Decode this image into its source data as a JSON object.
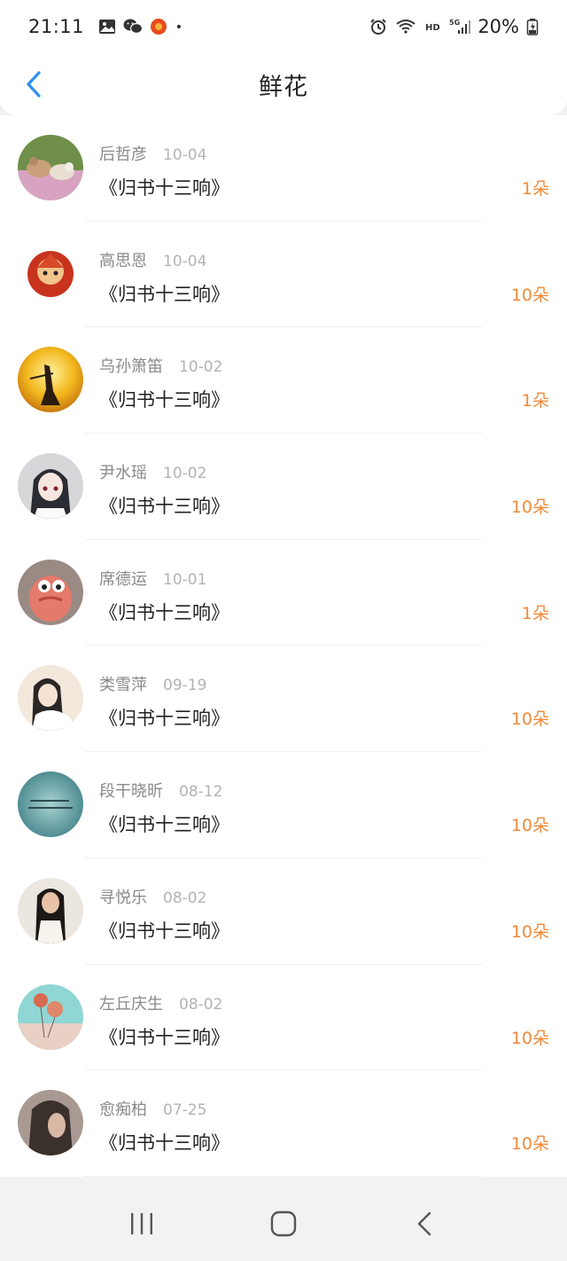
{
  "status_bar": {
    "time": "21:11",
    "battery": "20%",
    "icons_left": [
      "gallery-icon",
      "wechat-icon",
      "app-badge-icon",
      "dot-icon"
    ],
    "icons_right": [
      "alarm-icon",
      "wifi-icon",
      "hd-icon",
      "signal-5g-icon",
      "battery-charging-icon"
    ]
  },
  "header": {
    "title": "鲜花",
    "back_icon": "chevron-left-icon"
  },
  "list": [
    {
      "name": "后哲彦",
      "date": "10-04",
      "title": "《归书十三响》",
      "amount": "1朵"
    },
    {
      "name": "高思恩",
      "date": "10-04",
      "title": "《归书十三响》",
      "amount": "10朵"
    },
    {
      "name": "乌孙箫笛",
      "date": "10-02",
      "title": "《归书十三响》",
      "amount": "1朵"
    },
    {
      "name": "尹水瑶",
      "date": "10-02",
      "title": "《归书十三响》",
      "amount": "10朵"
    },
    {
      "name": "席德运",
      "date": "10-01",
      "title": "《归书十三响》",
      "amount": "1朵"
    },
    {
      "name": "类雪萍",
      "date": "09-19",
      "title": "《归书十三响》",
      "amount": "10朵"
    },
    {
      "name": "段干晓昕",
      "date": "08-12",
      "title": "《归书十三响》",
      "amount": "10朵"
    },
    {
      "name": "寻悦乐",
      "date": "08-02",
      "title": "《归书十三响》",
      "amount": "10朵"
    },
    {
      "name": "左丘庆生",
      "date": "08-02",
      "title": "《归书十三响》",
      "amount": "10朵"
    },
    {
      "name": "愈痴柏",
      "date": "07-25",
      "title": "《归书十三响》",
      "amount": "10朵"
    }
  ],
  "colors": {
    "accent_blue": "#2f8ff0",
    "amount_orange": "#ef8a3a",
    "name_gray": "#8a8a8a",
    "date_gray": "#b3b3b3"
  },
  "nav_bar": {
    "icons": [
      "recent-apps-icon",
      "home-icon",
      "back-icon"
    ]
  }
}
